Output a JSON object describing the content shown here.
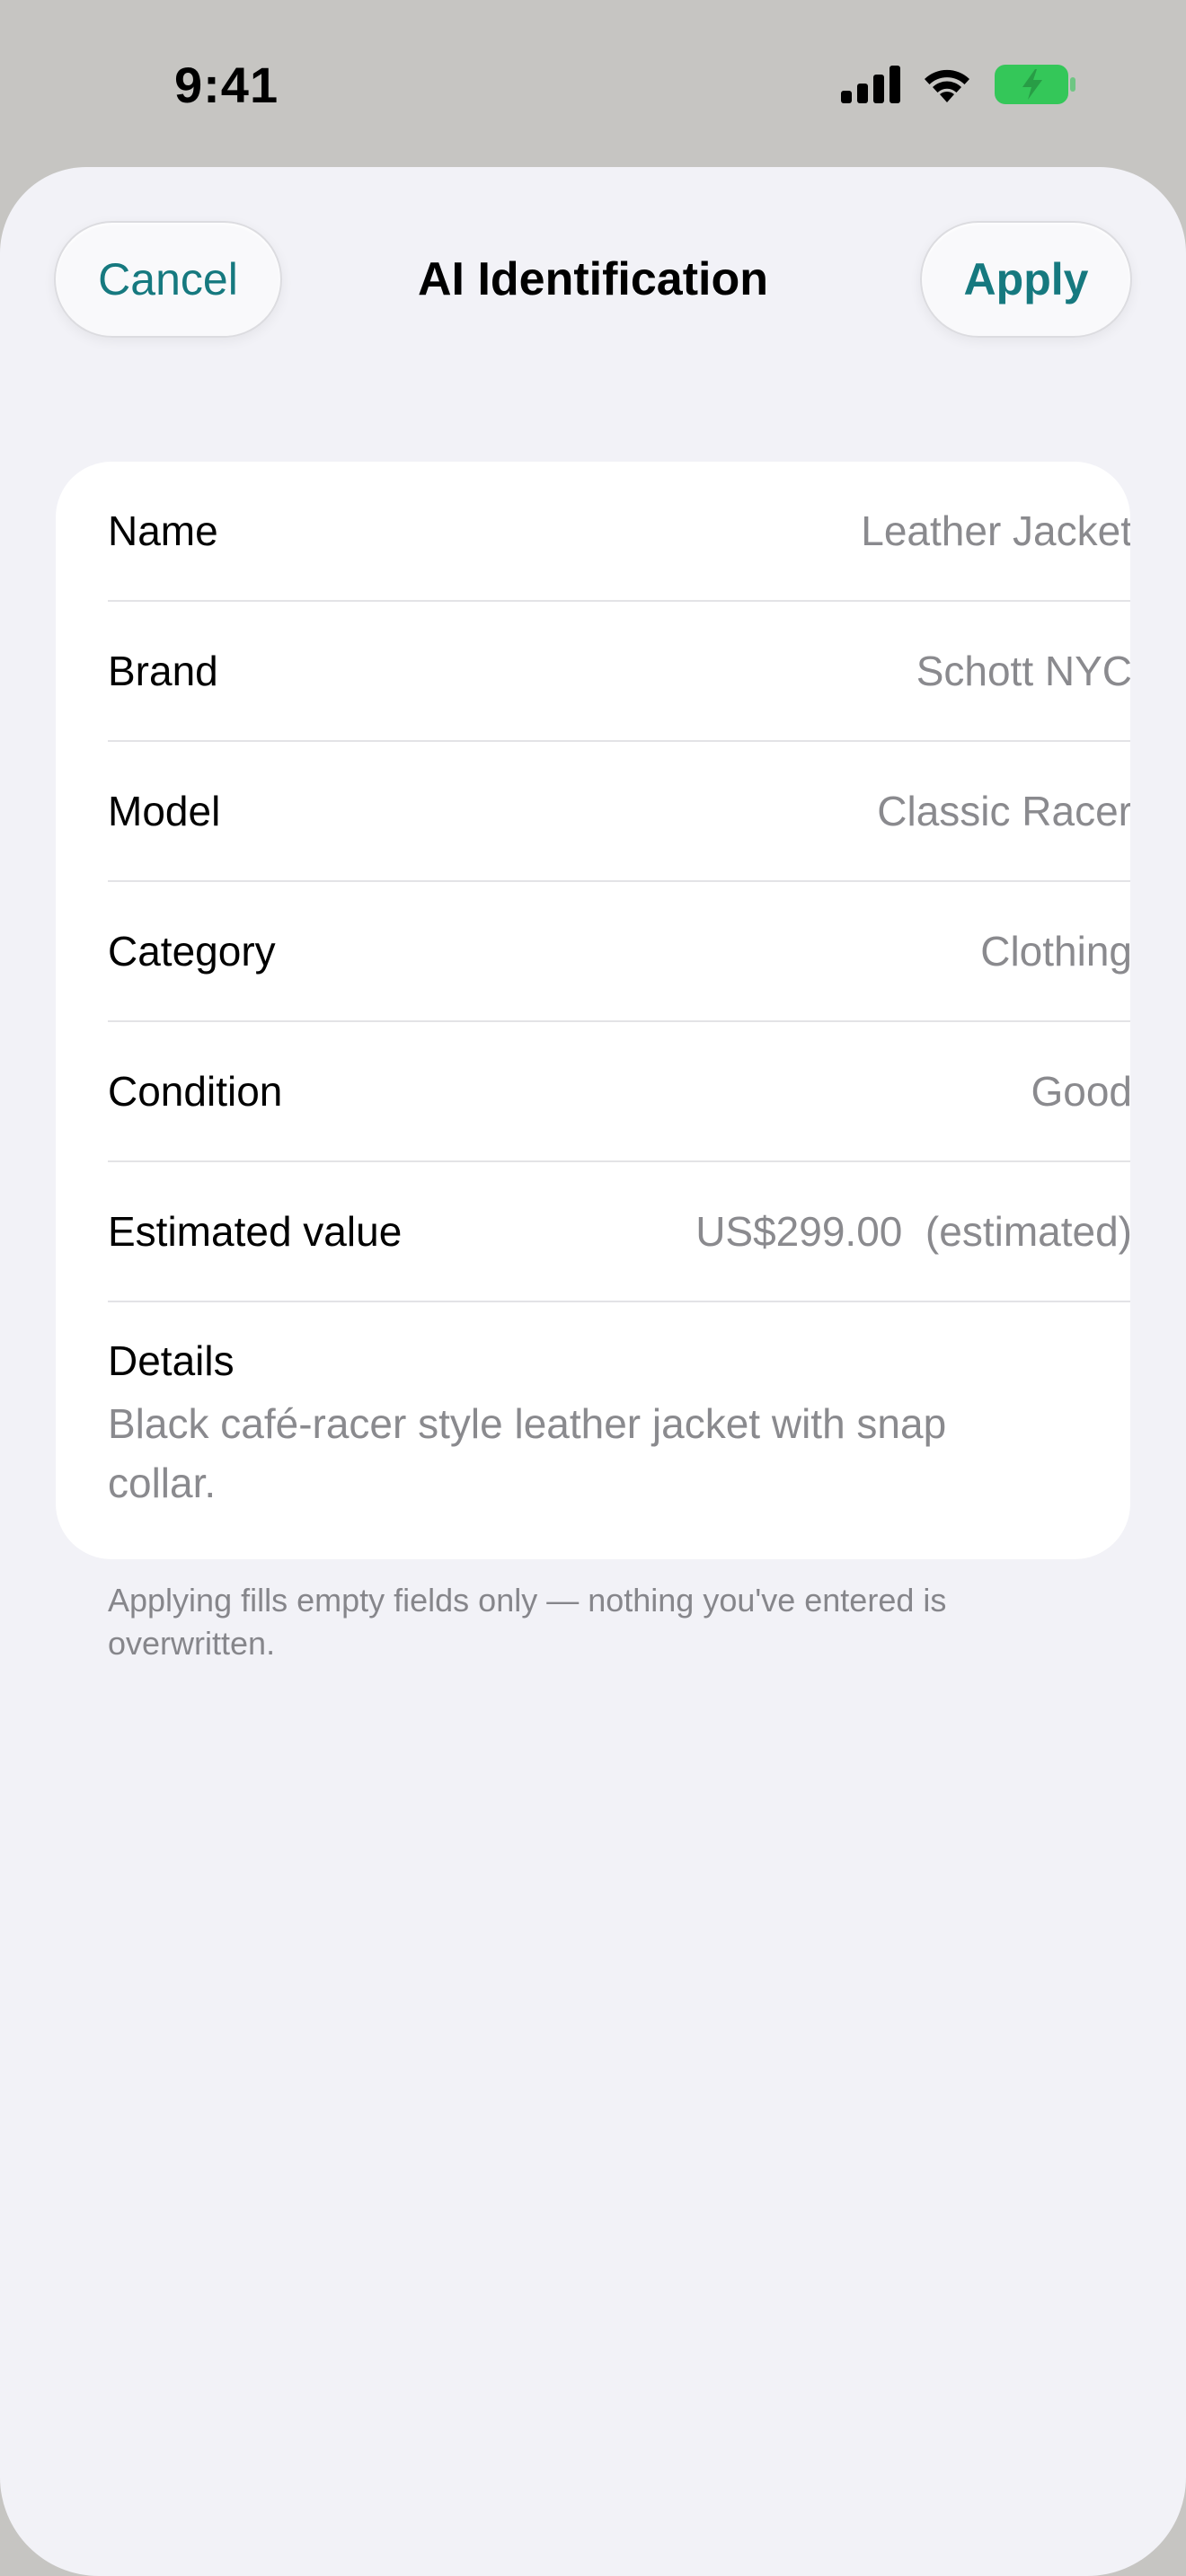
{
  "status_bar": {
    "time": "9:41"
  },
  "nav": {
    "cancel_label": "Cancel",
    "title": "AI Identification",
    "apply_label": "Apply"
  },
  "fields": [
    {
      "label": "Name",
      "value": "Leather Jacket"
    },
    {
      "label": "Brand",
      "value": "Schott NYC"
    },
    {
      "label": "Model",
      "value": "Classic Racer"
    },
    {
      "label": "Category",
      "value": "Clothing"
    },
    {
      "label": "Condition",
      "value": "Good"
    },
    {
      "label": "Estimated value",
      "value": "US$299.00  (estimated)"
    }
  ],
  "details": {
    "label": "Details",
    "text": "Black café-racer style leather jacket with snap collar."
  },
  "footnote": "Applying fills empty fields only — nothing you've entered is overwritten.",
  "colors": {
    "accent": "#16797f",
    "sheet_background": "#f2f2f7",
    "card_background": "#ffffff",
    "secondary_text": "#8a8a8e",
    "battery_green": "#34c759"
  },
  "icons": [
    "cellular-signal-icon",
    "wifi-icon",
    "battery-charging-icon"
  ]
}
